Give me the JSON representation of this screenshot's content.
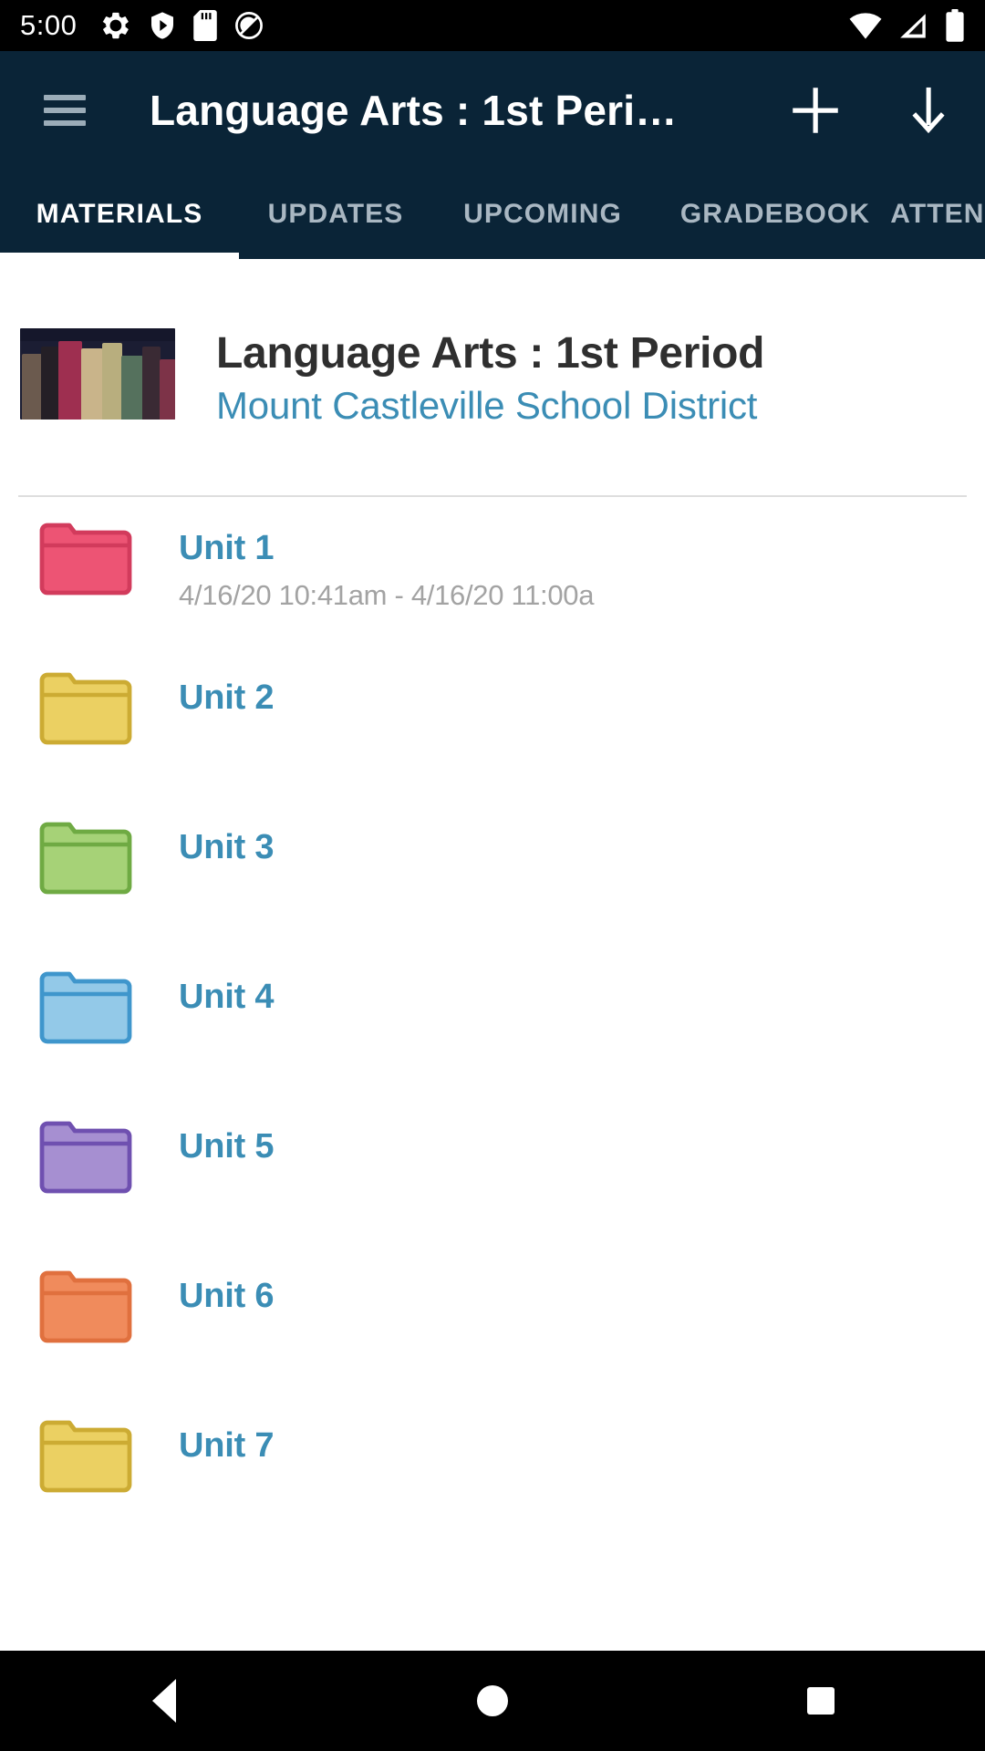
{
  "status_bar": {
    "clock": "5:00",
    "left_icons": [
      "settings-gear-icon",
      "play-protect-shield-icon",
      "sd-card-icon",
      "data-saver-off-icon"
    ],
    "right_icons": [
      "wifi-icon",
      "no-sim-signal-icon",
      "battery-full-icon"
    ]
  },
  "app_bar": {
    "menu_icon": "hamburger-menu-icon",
    "title": "Language Arts : 1st Peri…",
    "add_icon": "plus-icon",
    "download_icon": "download-arrow-icon",
    "background_color": "#0a2437"
  },
  "tabs": {
    "active_index": 0,
    "items": [
      {
        "label": "MATERIALS"
      },
      {
        "label": "UPDATES"
      },
      {
        "label": "UPCOMING"
      },
      {
        "label": "GRADEBOOK"
      },
      {
        "label": "ATTENDANCE"
      }
    ]
  },
  "course": {
    "thumbnail_icon": "books-photo-thumbnail",
    "title": "Language Arts : 1st Period",
    "district": "Mount Castleville School District",
    "title_color": "#2f2f2f",
    "district_color": "#3b8db5"
  },
  "units": [
    {
      "name": "Unit 1",
      "dates": "4/16/20 10:41am - 4/16/20 11:00a",
      "folder_color": "#ed5474",
      "folder_border": "#d23b5c",
      "icon": "folder-icon"
    },
    {
      "name": "Unit 2",
      "dates": "",
      "folder_color": "#ebd062",
      "folder_border": "#ccab33",
      "icon": "folder-icon"
    },
    {
      "name": "Unit 3",
      "dates": "",
      "folder_color": "#a6d277",
      "folder_border": "#6faa43",
      "icon": "folder-icon"
    },
    {
      "name": "Unit 4",
      "dates": "",
      "folder_color": "#93c9e8",
      "folder_border": "#3f96cc",
      "icon": "folder-icon"
    },
    {
      "name": "Unit 5",
      "dates": "",
      "folder_color": "#a68fd1",
      "folder_border": "#6f50b0",
      "icon": "folder-icon"
    },
    {
      "name": "Unit 6",
      "dates": "",
      "folder_color": "#f08b5c",
      "folder_border": "#e0703e",
      "icon": "folder-icon"
    },
    {
      "name": "Unit 7",
      "dates": "",
      "folder_color": "#ebd062",
      "folder_border": "#ccab33",
      "icon": "folder-icon"
    }
  ],
  "nav_bar": {
    "back_label": "back-button",
    "home_label": "home-button",
    "recents_label": "recents-button"
  }
}
